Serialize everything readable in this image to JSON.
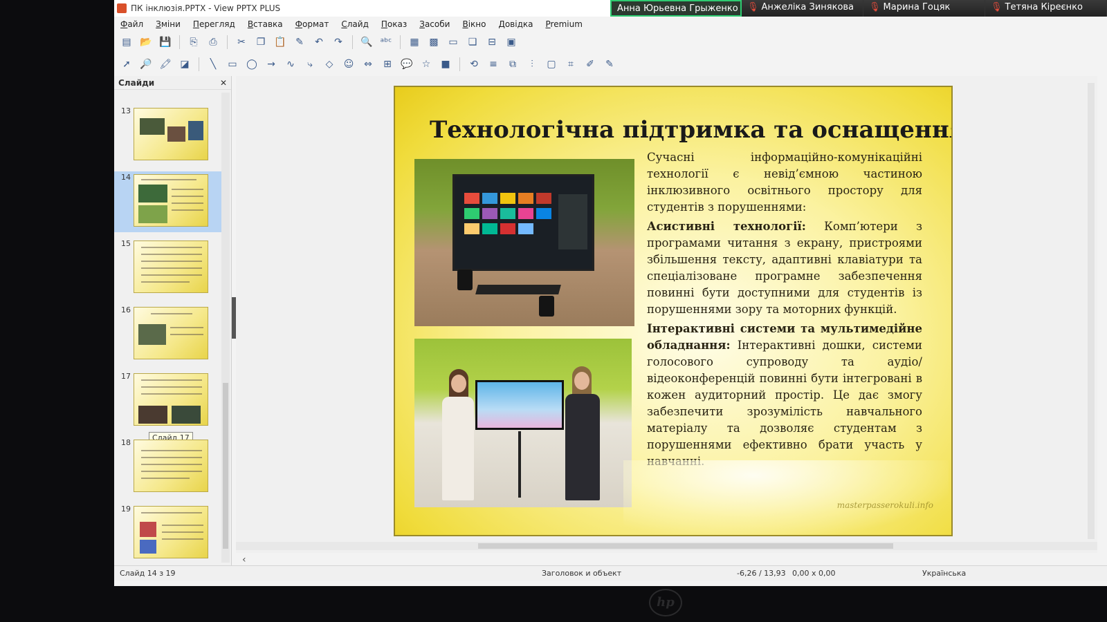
{
  "window": {
    "title": "ПК інклюзія.PPTX - View PPTX PLUS"
  },
  "participants": [
    {
      "name": "Анна Юрьевна Грыженко",
      "muted": false
    },
    {
      "name": "Анжеліка Зинякова",
      "muted": true
    },
    {
      "name": "Марина Гоцяк",
      "muted": true
    },
    {
      "name": "Тетяна Кіреєнко",
      "muted": true
    }
  ],
  "menu": [
    "Файл",
    "Зміни",
    "Перегляд",
    "Вставка",
    "Формат",
    "Слайд",
    "Показ",
    "Засоби",
    "Вікно",
    "Довідка",
    "Premium"
  ],
  "slides_panel": {
    "title": "Слайди",
    "close_icon": "close-icon",
    "thumbnails": [
      {
        "number": "13"
      },
      {
        "number": "14",
        "selected": true
      },
      {
        "number": "15"
      },
      {
        "number": "16"
      },
      {
        "number": "17"
      },
      {
        "number": "18"
      },
      {
        "number": "19"
      }
    ],
    "tooltip": "Слайд 17"
  },
  "slide": {
    "title": "Технологічна підтримка та оснащення",
    "para1": "Сучасні інформаційно-комунікаційні технології є невід’ємною частиною інклюзивного освітнього простору для студентів з порушеннями:",
    "para2_bold": "Асистивні технології:",
    "para2": " Комп’ютери з програмами читання з екрану, пристроями збільшення тексту, адаптивні клавіатури та спеціалізоване програмне забезпечення повинні бути доступними для студентів із порушеннями зору та моторних функцій.",
    "para3_bold": "Інтерактивні системи та мультимедійне обладнання:",
    "para3": " Інтерактивні дошки, системи голосового супроводу та аудіо/відеоконференцій повинні бути інтегровані в кожен аудиторний простір. Це дає змогу забезпечити зрозумілість навчального матеріалу та дозволяє студентам з порушеннями ефективно брати участь у навчанні.",
    "watermark": "masterpasserokuli.info"
  },
  "statusbar": {
    "slide_counter": "Слайд 14 з 19",
    "layout": "Заголовок и объект",
    "position": "-6,26 / 13,93",
    "size": "0,00 x 0,00",
    "language": "Українська"
  },
  "colors": {
    "slide_bg": "#fbf2a0",
    "slide_border": "#e8cc1c",
    "selection": "#9fc3ee"
  }
}
